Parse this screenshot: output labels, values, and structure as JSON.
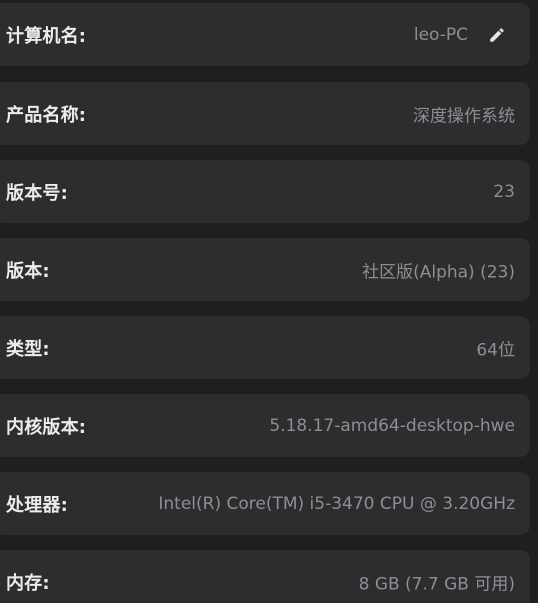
{
  "system_info": {
    "rows": [
      {
        "label": "计算机名:",
        "value": "leo-PC",
        "editable": true,
        "action_icon": "pencil-icon"
      },
      {
        "label": "产品名称:",
        "value": "深度操作系统"
      },
      {
        "label": "版本号:",
        "value": "23"
      },
      {
        "label": "版本:",
        "value": "社区版(Alpha) (23)"
      },
      {
        "label": "类型:",
        "value": "64位"
      },
      {
        "label": "内核版本:",
        "value": "5.18.17-amd64-desktop-hwe"
      },
      {
        "label": "处理器:",
        "value": "Intel(R) Core(TM) i5-3470 CPU @ 3.20GHz"
      },
      {
        "label": "内存:",
        "value": "8 GB (7.7 GB 可用)"
      }
    ]
  },
  "colors": {
    "background": "#1f1f1f",
    "row_background": "#2d2d2d",
    "label_text": "#ececec",
    "value_text": "#8a8f99"
  }
}
